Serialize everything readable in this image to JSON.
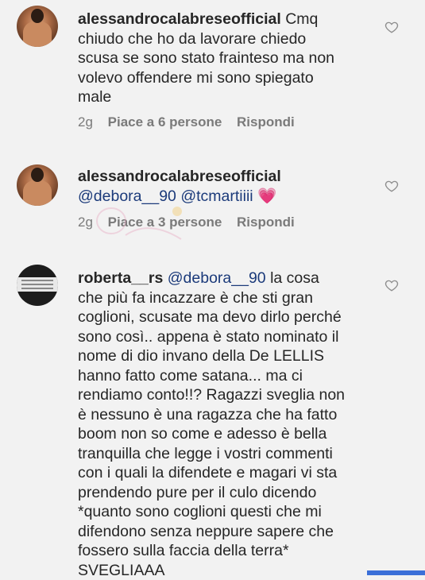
{
  "comments": [
    {
      "username": "alessandrocalabreseofficial",
      "text": "Cmq chiudo che ho da lavorare chiedo scusa se sono stato frainteso ma non volevo offendere mi sono spiegato male",
      "time": "2g",
      "likes": "Piace a 6 persone",
      "reply": "Rispondi",
      "avatar": "profile-photo"
    },
    {
      "username": "alessandrocalabreseofficial",
      "mention1": "@debora__90",
      "mention2": "@tcmartiiii",
      "emoji": "💗",
      "time": "2g",
      "likes": "Piace a 3 persone",
      "reply": "Rispondi",
      "avatar": "profile-photo"
    },
    {
      "username": "roberta__rs",
      "mention": "@debora__90",
      "text": "la cosa che più fa incazzare è che sti gran coglioni, scusate ma devo dirlo perché sono così.. appena è stato nominato il nome di dio invano della De LELLIS hanno fatto come satana... ma ci rendiamo conto!!? Ragazzi sveglia non è nessuno è una ragazza che ha fatto boom non so come e adesso è bella tranquilla che legge i vostri commenti con i quali la difendete e magari vi sta prendendo pure per il culo dicendo *quanto sono coglioni questi che mi difendono senza neppure sapere che fossero sulla faccia della terra* SVEGLIAAA",
      "avatar": "text-image"
    }
  ],
  "icons": {
    "like": "heart-outline-icon"
  },
  "colors": {
    "mention": "#1b3a7a",
    "meta": "#7a7a7a",
    "background": "#f2f2f2"
  }
}
